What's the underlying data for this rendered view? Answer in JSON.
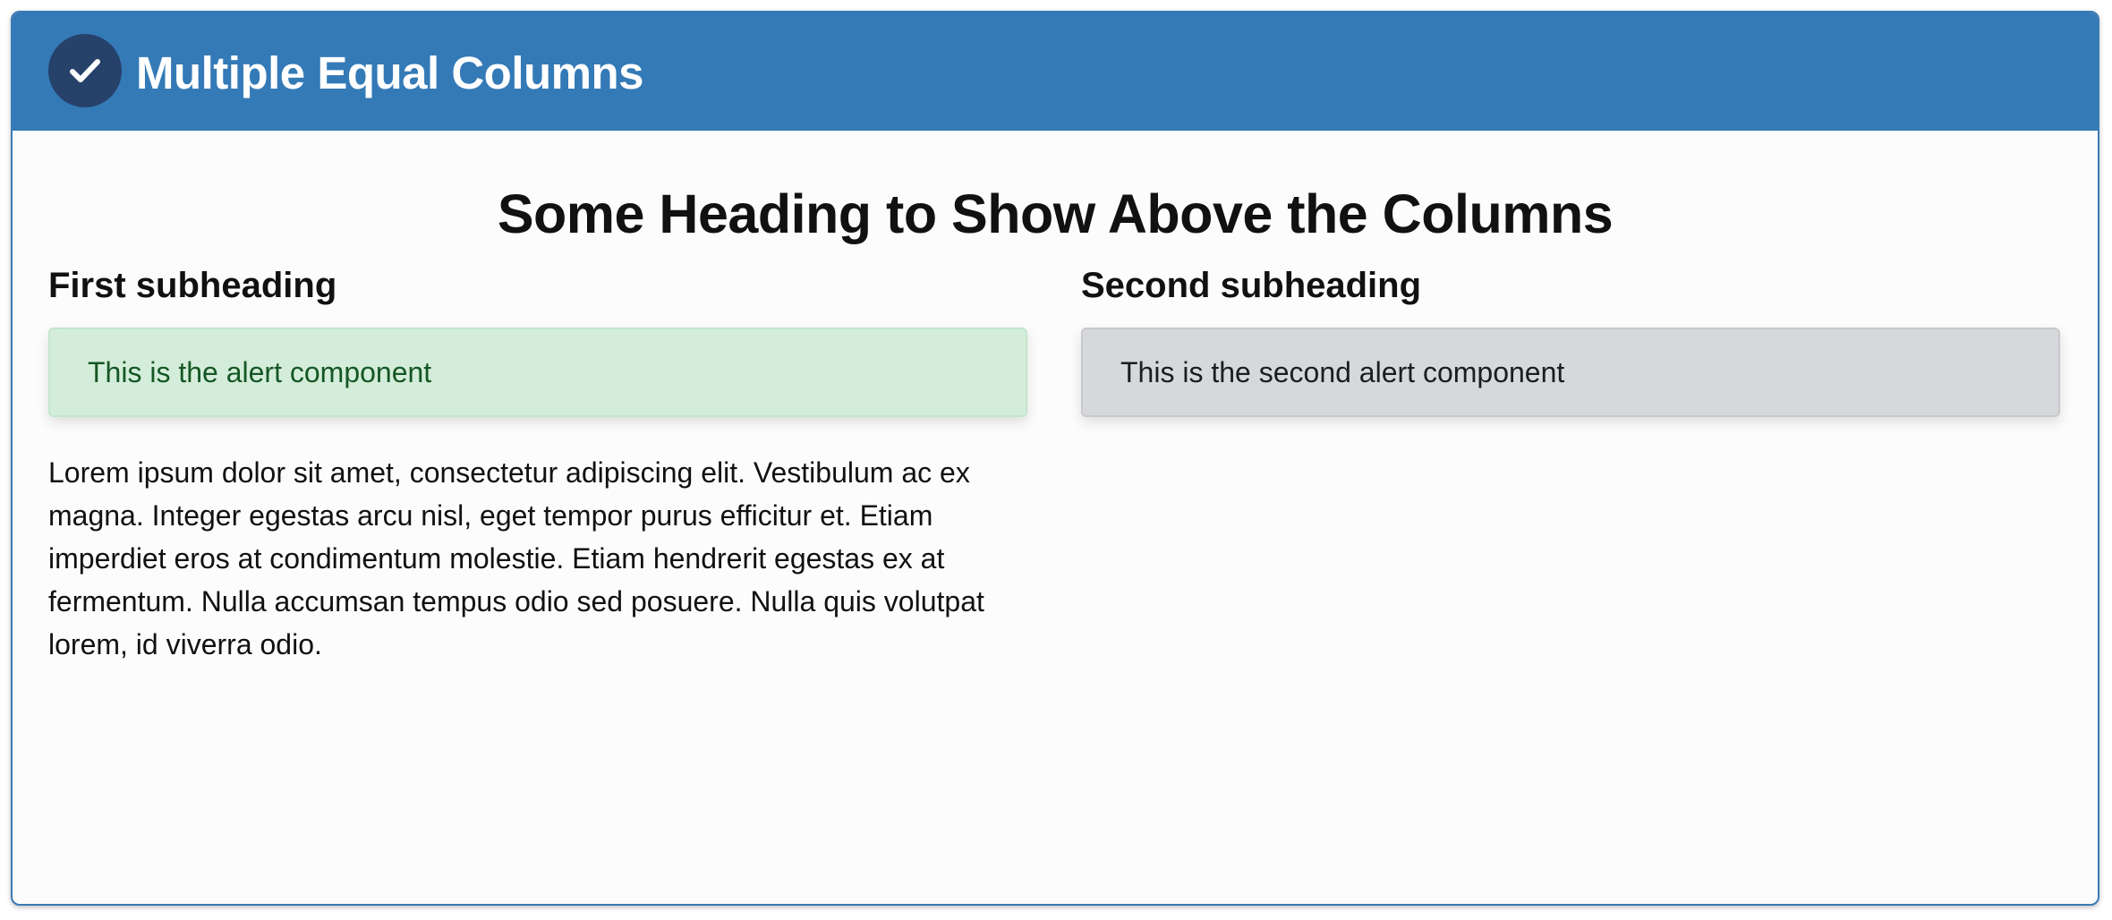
{
  "header": {
    "title": "Multiple Equal Columns",
    "icon": "check-icon",
    "background": "#347ab7"
  },
  "main": {
    "heading": "Some Heading to Show Above the Columns",
    "columns": [
      {
        "subheading": "First subheading",
        "alert": {
          "text": "This is the alert component",
          "variant": "success",
          "color": "#d4edda"
        },
        "body": "Lorem ipsum dolor sit amet, consectetur adipiscing elit. Vestibulum ac ex magna. Integer egestas arcu nisl, eget tempor purus efficitur et. Etiam imperdiet eros at condimentum molestie. Etiam hendrerit egestas ex at fermentum. Nulla accumsan tempus odio sed posuere. Nulla quis volutpat lorem, id viverra odio."
      },
      {
        "subheading": "Second subheading",
        "alert": {
          "text": "This is the second alert component",
          "variant": "secondary",
          "color": "#d6d8db"
        }
      }
    ]
  }
}
